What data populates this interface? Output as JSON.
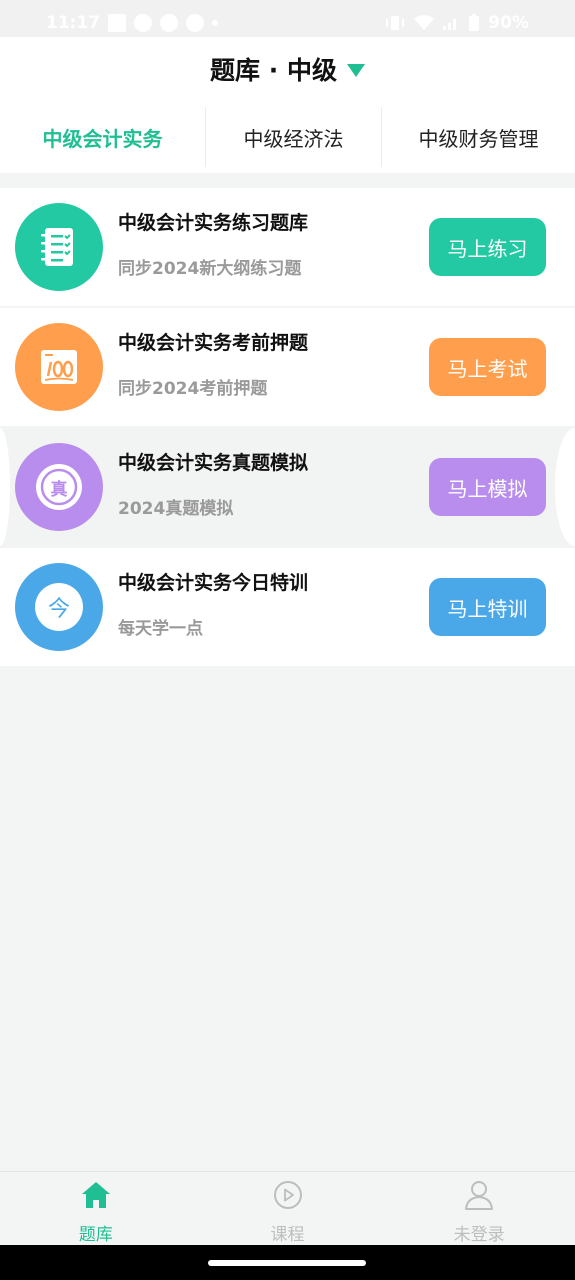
{
  "status_bar": {
    "time": "11:17",
    "battery": "90%"
  },
  "header": {
    "title": "题库 · 中级"
  },
  "tabs": [
    {
      "label": "中级会计实务",
      "active": true
    },
    {
      "label": "中级经济法",
      "active": false
    },
    {
      "label": "中级财务管理",
      "active": false
    }
  ],
  "items": [
    {
      "title": "中级会计实务练习题库",
      "subtitle": "同步2024新大纲练习题",
      "button": "马上练习",
      "color": "#22c9a2",
      "icon": "checklist-icon"
    },
    {
      "title": "中级会计实务考前押题",
      "subtitle": "同步2024考前押题",
      "button": "马上考试",
      "color": "#ff9f4e",
      "icon": "score-100-icon"
    },
    {
      "title": "中级会计实务真题模拟",
      "subtitle": "2024真题模拟",
      "button": "马上模拟",
      "color": "#b98ded",
      "icon": "zhen-seal-icon",
      "icon_text": "真"
    },
    {
      "title": "中级会计实务今日特训",
      "subtitle": "每天学一点",
      "button": "马上特训",
      "color": "#4aa7e8",
      "icon": "jin-today-icon",
      "icon_text": "今"
    }
  ],
  "bottom_nav": [
    {
      "label": "题库",
      "icon": "home-icon",
      "active": true
    },
    {
      "label": "课程",
      "icon": "play-circle-icon",
      "active": false
    },
    {
      "label": "未登录",
      "icon": "user-icon",
      "active": false
    }
  ],
  "colors": {
    "accent": "#1fbe93",
    "inactive": "#bdbdbd",
    "background": "#f3f4f4"
  }
}
